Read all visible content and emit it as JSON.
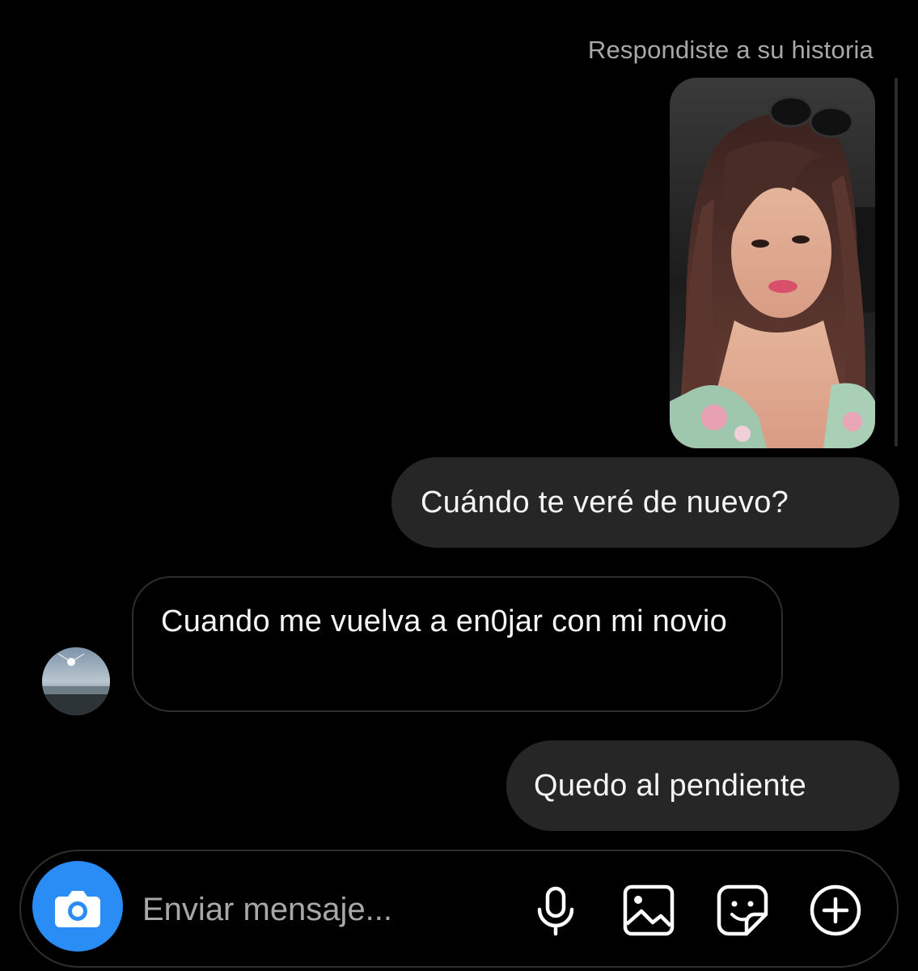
{
  "story_reply": {
    "label": "Respondiste a su historia"
  },
  "messages": [
    {
      "direction": "outgoing",
      "text": "Cuándo te veré de nuevo?"
    },
    {
      "direction": "incoming",
      "text": "Cuando me vuelva a en0jar con mi novio"
    },
    {
      "direction": "outgoing",
      "text": "Quedo al pendiente"
    }
  ],
  "composer": {
    "placeholder": "Enviar mensaje...",
    "value": "",
    "icons": [
      "camera-icon",
      "microphone-icon",
      "gallery-icon",
      "sticker-icon",
      "plus-icon"
    ]
  },
  "colors": {
    "background": "#000000",
    "outgoing_bubble": "#262626",
    "incoming_border": "#2e2e2e",
    "accent": "#2a8cf5",
    "muted_text": "#a8a8a8"
  }
}
